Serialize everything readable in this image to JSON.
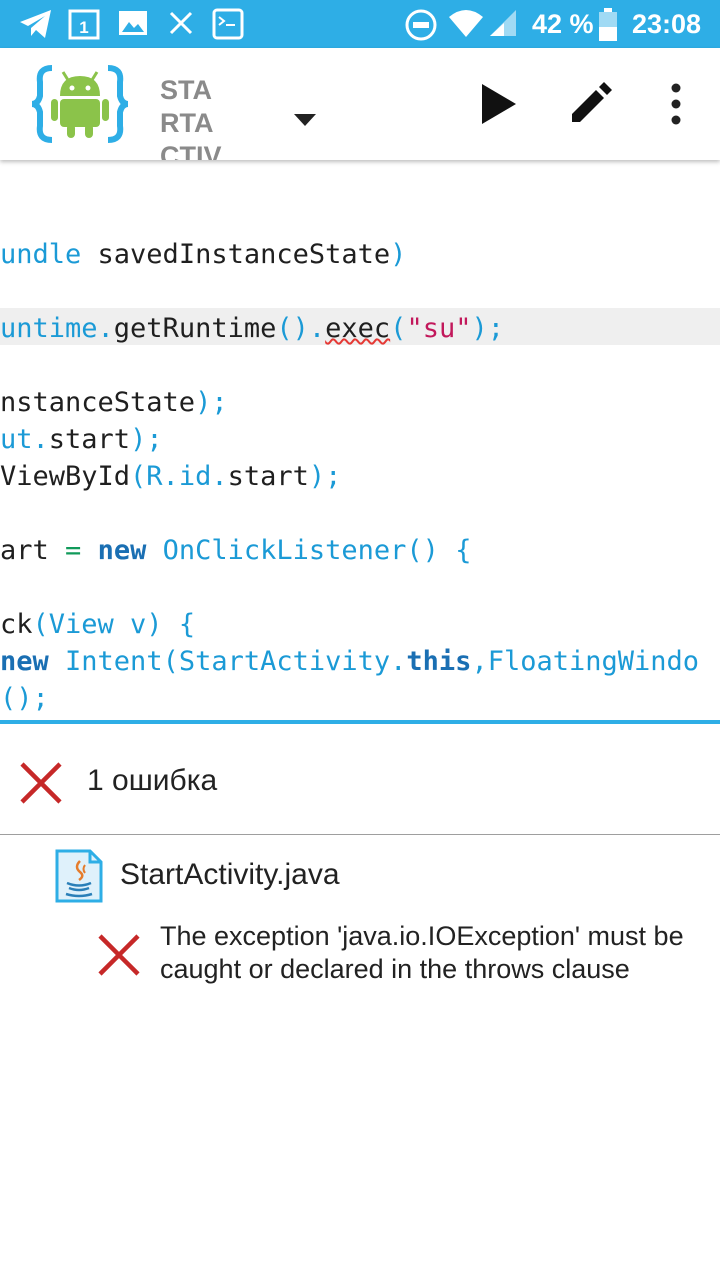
{
  "status_bar": {
    "battery_percent": "42 %",
    "time": "23:08",
    "icons": [
      "telegram-icon",
      "calendar-icon",
      "image-icon",
      "close-icon",
      "terminal-icon",
      "do-not-disturb-icon",
      "wifi-icon",
      "signal-icon",
      "battery-icon"
    ],
    "calendar_day": "1"
  },
  "toolbar": {
    "file_title": "STARTACTIV",
    "icons": [
      "app-logo-icon",
      "dropdown-arrow-icon",
      "run-icon",
      "edit-icon",
      "more-vert-icon"
    ]
  },
  "code": {
    "line1": [
      "undle",
      " savedInstanceState",
      ")"
    ],
    "line2": [
      "untime.",
      "getRuntime",
      "().",
      "exec",
      "(",
      "\"su\"",
      ");"
    ],
    "line3": [
      "nstanceState",
      ");"
    ],
    "line4": [
      "ut.",
      "start",
      ");"
    ],
    "line5": [
      "ViewById",
      "(R.id.",
      "start",
      ");"
    ],
    "line6": [
      "art ",
      "=",
      " ",
      "new",
      " OnClickListener() {"
    ],
    "line7": [
      "ck",
      "(View",
      " v) {"
    ],
    "line8": [
      "new",
      " Intent(StartActivity.",
      "this",
      ",FloatingWindo"
    ],
    "line9": [
      "();"
    ]
  },
  "colors": {
    "accent": "#2eaee6",
    "error": "#c62828",
    "keyword": "#1a6fb3",
    "type": "#1b9ad6",
    "string": "#c2185b"
  },
  "errors": {
    "count_label": "1 ошибка",
    "file_name": "StartActivity.java",
    "message": "The exception 'java.io.IOException' must be caught or declared in the throws clause"
  }
}
